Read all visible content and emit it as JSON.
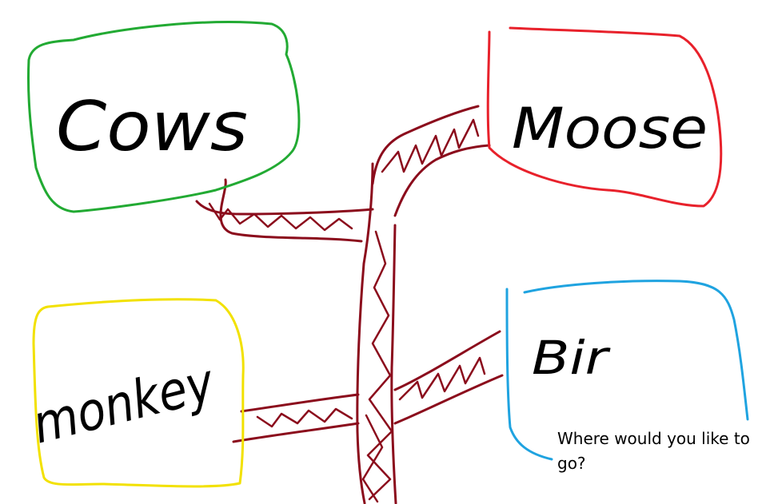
{
  "nodes": {
    "cows": {
      "label": "Cows",
      "color": "#22aa33"
    },
    "moose": {
      "label": "Moose",
      "color": "#e8212b"
    },
    "monkey": {
      "label": "monkey",
      "color": "#f2e100"
    },
    "bird": {
      "label": "Bir",
      "color": "#1fa3e0"
    }
  },
  "path_color": "#8b0c1c",
  "prompt": {
    "text": "Where would you like to go?"
  }
}
